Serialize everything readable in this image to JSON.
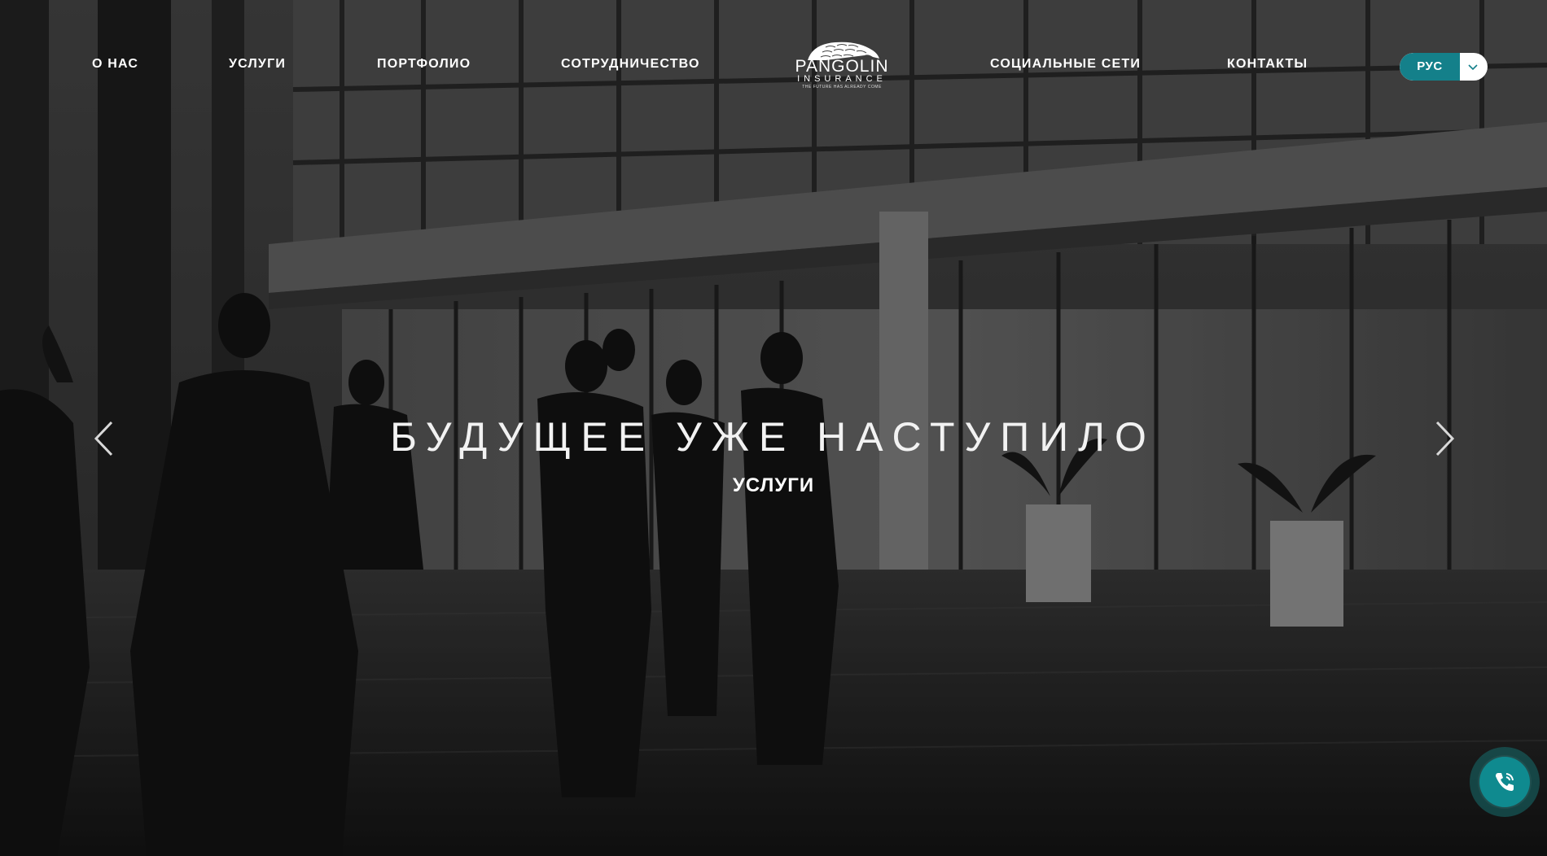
{
  "nav": {
    "about": "О НАС",
    "services": "УСЛУГИ",
    "portfolio": "ПОРТФОЛИО",
    "cooperation": "СОТРУДНИЧЕСТВО",
    "social": "СОЦИАЛЬНЫЕ СЕТИ",
    "contacts": "КОНТАКТЫ"
  },
  "logo": {
    "word": "PANGOLIN",
    "sub": "INSURANCE",
    "tagline": "THE FUTURE HAS ALREADY COME",
    "icon": "pangolin-icon"
  },
  "language": {
    "selected": "РУС",
    "chevron_icon": "chevron-down-icon"
  },
  "hero": {
    "headline": "БУДУЩЕЕ УЖЕ НАСТУПИЛО",
    "link_label": "УСЛУГИ",
    "prev_icon": "chevron-left-icon",
    "next_icon": "chevron-right-icon"
  },
  "call_button": {
    "icon": "phone-icon",
    "color": "#0f8a8f"
  },
  "colors": {
    "accent": "#14808a",
    "text": "#ffffff"
  }
}
